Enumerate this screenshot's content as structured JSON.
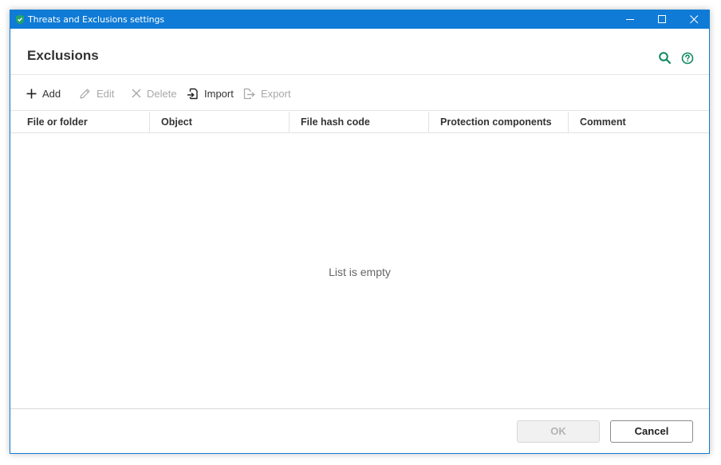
{
  "window": {
    "title": "Threats and Exclusions settings"
  },
  "header": {
    "title": "Exclusions"
  },
  "toolbar": {
    "add_label": "Add",
    "edit_label": "Edit",
    "delete_label": "Delete",
    "import_label": "Import",
    "export_label": "Export"
  },
  "table": {
    "columns": [
      "File or folder",
      "Object",
      "File hash code",
      "Protection components",
      "Comment"
    ],
    "empty_message": "List is empty"
  },
  "footer": {
    "ok_label": "OK",
    "cancel_label": "Cancel"
  },
  "colors": {
    "titlebar": "#0f7bd6",
    "accent_green": "#0f8a5f"
  }
}
